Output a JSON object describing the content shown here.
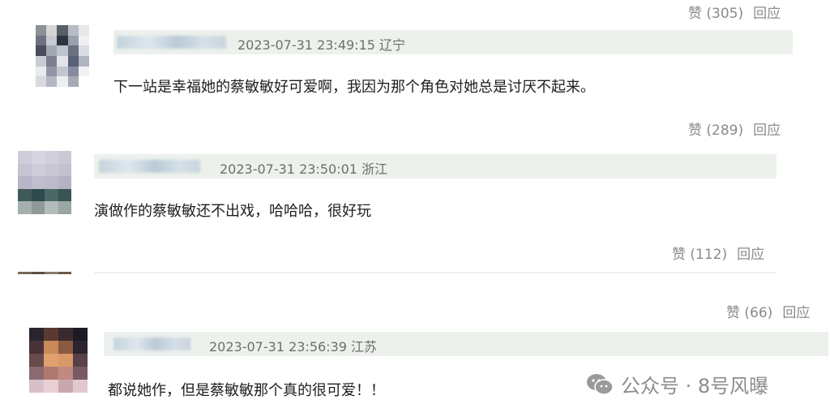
{
  "comments": [
    {
      "meta": "2023-07-31 23:49:15 辽宁",
      "text": "下一站是幸福她的蔡敏敏好可爱啊，我因为那个角色对她总是讨厌不起来。",
      "likes": "赞 (305)",
      "reply": "回应"
    },
    {
      "meta": "2023-07-31 23:50:01 浙江",
      "text": "演做作的蔡敏敏还不出戏，哈哈哈，很好玩",
      "likes": "赞 (289)",
      "reply": "回应"
    },
    {
      "meta": "",
      "text": "",
      "likes": "赞 (112)",
      "reply": "回应"
    },
    {
      "meta": "2023-07-31 23:56:39 江苏",
      "text": "都说她作，但是蔡敏敏那个真的很可爱！！",
      "likes": "赞 (66)",
      "reply": "回应"
    }
  ],
  "watermark": {
    "icon": "wechat-icon",
    "text": "公众号 · 8号风曝"
  },
  "colors": {
    "header_bg": "#edf1ec",
    "action_text": "#8a8a8a",
    "meta_text": "#6e6e6e"
  }
}
